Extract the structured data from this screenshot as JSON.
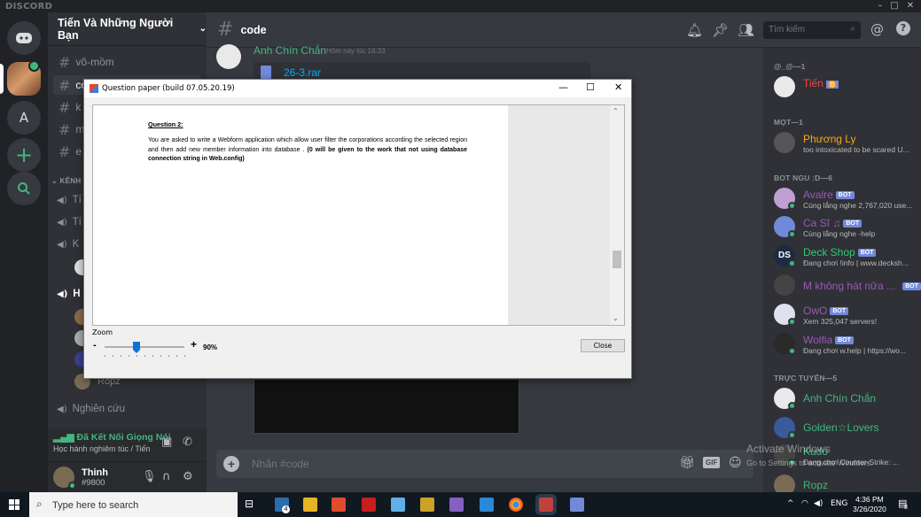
{
  "window": {
    "logo": "DISCORD",
    "min": "–",
    "max": "□",
    "close": "✕"
  },
  "servers": [
    {
      "label": "A"
    }
  ],
  "guild": {
    "name": "Tiến Và Những Người Bạn"
  },
  "channels": {
    "text": [
      {
        "label": "võ-mồm"
      },
      {
        "label": "co"
      },
      {
        "label": "k"
      },
      {
        "label": "m"
      },
      {
        "label": "e"
      }
    ],
    "voice_category": "KÊNH Đ",
    "voice": [
      {
        "label": "Tí"
      },
      {
        "label": "Tí"
      },
      {
        "label": "K"
      },
      {
        "label": "H"
      }
    ],
    "voice_user": "Ropz",
    "nghien": "Nghiên cứu"
  },
  "voicebar": {
    "status": "Đã Kết Nối Giọng Nói",
    "sub": "Học hành nghiêm túc / Tiến ..."
  },
  "user": {
    "name": "Thinh",
    "tag": "#9800"
  },
  "chat": {
    "channel": "code",
    "search_placeholder": "Tìm kiếm",
    "message": {
      "author": "Anh Chín Chắn",
      "time": "Hôm nay lúc 16:33",
      "file": "26-3.rar"
    },
    "input_placeholder": "Nhắn #code",
    "gif": "GIF"
  },
  "members": {
    "groups": [
      {
        "title": "@_@—1",
        "members": [
          {
            "name": "Tiến",
            "badge": "♊",
            "color": "#f04747",
            "activity": ""
          }
        ]
      },
      {
        "title": "MỌT—1",
        "members": [
          {
            "name": "Phương Ly",
            "color": "#faa61a",
            "activity": "too intoxicated to be scared U..."
          }
        ]
      },
      {
        "title": "BOT NGU :D—6",
        "members": [
          {
            "name": "Avalre",
            "bot": "BOT",
            "color": "#9b59b6",
            "activity": "Cùng lắng nghe 2,767,020 use..."
          },
          {
            "name": "Ca Sĩ ♫",
            "bot": "BOT",
            "color": "#9b59b6",
            "activity": "Cùng lắng nghe -help"
          },
          {
            "name": "Deck Shop",
            "bot": "BOT",
            "color": "#2ecc71",
            "activity": "Đang chơi !info | www.decksh..."
          },
          {
            "name": "M không hát nữa ...",
            "bot": "BOT",
            "color": "#9b59b6",
            "activity": ""
          },
          {
            "name": "OwO",
            "bot": "BOT",
            "color": "#9b59b6",
            "activity": "Xem 325,047 servers!"
          },
          {
            "name": "Wolfia",
            "bot": "BOT",
            "color": "#9b59b6",
            "activity": "Đang chơi w.help | https://wo..."
          }
        ]
      },
      {
        "title": "TRỰC TUYẾN—5",
        "members": [
          {
            "name": "Anh Chín Chắn",
            "color": "#43b581",
            "activity": ""
          },
          {
            "name": "Golden☆Lovers",
            "color": "#43b581",
            "activity": ""
          },
          {
            "name": "Kudo",
            "color": "#43b581",
            "activity": "Đang chơi Counter-Strike: ..."
          },
          {
            "name": "Ropz",
            "color": "#43b581",
            "activity": ""
          }
        ]
      }
    ],
    "watermark1": "Activate Windows",
    "watermark2": "Go to Settings to activate Windows."
  },
  "dialog": {
    "title": "Question paper (build 07.05.20.19)",
    "question_title": "Question 2:",
    "question_body": "You are asked to write a Webform application which allow user filter the corporations according the selected region and then add new member information into database .",
    "question_bold": "(0 will be given to the work that not using database connection string in Web.config)",
    "zoom_label": "Zoom",
    "zoom_minus": "-",
    "zoom_plus": "+",
    "zoom_value": "90%",
    "zoom_fraction": 0.4,
    "close_label": "Close"
  },
  "taskbar": {
    "search_placeholder": "Type here to search",
    "lang": "ENG",
    "time": "4:36 PM",
    "date": "3/26/2020",
    "notif": "8",
    "mail_badge": "4"
  },
  "colors": {
    "bg": "#36393f",
    "sidebar": "#2f3136",
    "rail": "#202225",
    "accent": "#7289da",
    "online": "#43b581"
  }
}
